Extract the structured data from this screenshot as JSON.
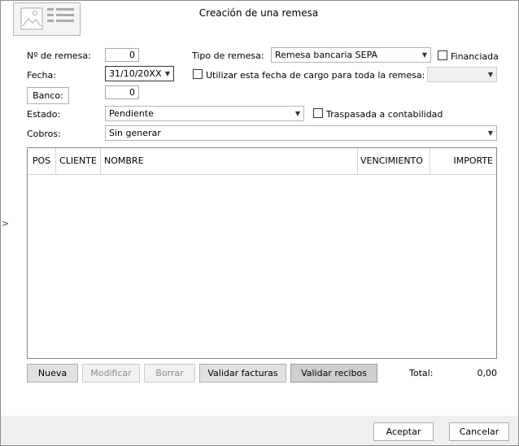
{
  "window": {
    "title": "Creación de una remesa"
  },
  "form": {
    "remesa_num": {
      "label": "Nº de remesa:",
      "value": "0"
    },
    "fecha": {
      "label": "Fecha:",
      "value": "31/10/20XX"
    },
    "banco": {
      "button_label": "Banco:",
      "value": "0"
    },
    "estado": {
      "label": "Estado:",
      "value": "Pendiente"
    },
    "cobros": {
      "label": "Cobros:",
      "value": "Sin generar"
    },
    "tipo_remesa": {
      "label": "Tipo de remesa:",
      "value": "Remesa bancaria SEPA"
    },
    "financiada": {
      "label": "Financiada",
      "checked": false
    },
    "usar_fecha": {
      "label": "Utilizar esta fecha de cargo para toda la remesa:",
      "checked": false,
      "value": ""
    },
    "traspasada": {
      "label": "Traspasada a contabilidad",
      "checked": false
    }
  },
  "grid": {
    "columns": [
      "POS",
      "CLIENTE",
      "NOMBRE",
      "VENCIMIENTO",
      "IMPORTE"
    ],
    "rows": []
  },
  "actions": {
    "nueva": "Nueva",
    "modificar": "Modificar",
    "borrar": "Borrar",
    "validar_facturas": "Validar facturas",
    "validar_recibos": "Validar recibos"
  },
  "total": {
    "label": "Total:",
    "value": "0,00"
  },
  "footer": {
    "aceptar": "Aceptar",
    "cancelar": "Cancelar"
  },
  "side_expander": {
    "glyph": ">"
  }
}
